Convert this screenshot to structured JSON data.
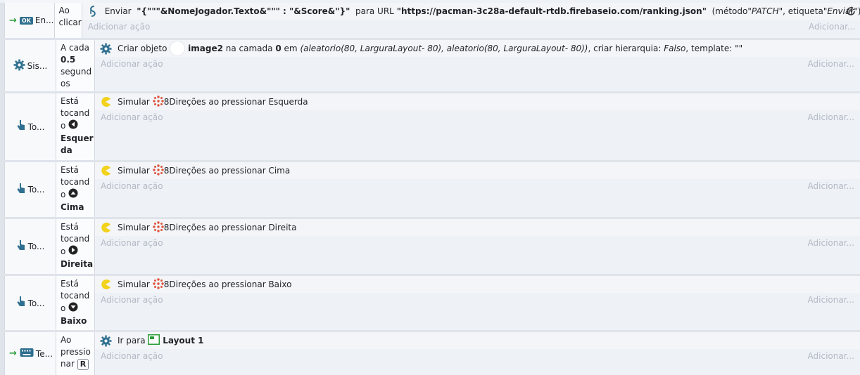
{
  "events": [
    {
      "object_label": "En...",
      "condition_lines": [
        "Ao",
        "clicar"
      ],
      "action": {
        "prefix": "Enviar",
        "body": "\"{\"\"\"&NomeJogador.Texto&\"\"\" : \"&Score&\"}\"",
        "mid": "para URL",
        "url": "\"https://pacman-3c28a-default-rtdb.firebaseio.com/ranking.json\"",
        "paren_open": "(método ",
        "method": "\"PATCH\"",
        "tag_label": ", etiqueta ",
        "tag": "\"Enviar\"",
        "paren_close": ")"
      },
      "add_action": "Adicionar ação",
      "add_right": "Adicionar..."
    },
    {
      "object_label": "Sis...",
      "condition_lines": [
        "A cada",
        "0.5",
        "segund",
        "os"
      ],
      "action": {
        "prefix": "Criar objeto",
        "object_name": "image2",
        "layer_label": "na camada",
        "layer": "0",
        "pos_label": "em",
        "pos": "(aleatorio(80, LarguraLayout- 80), aleatorio(80, LarguraLayout- 80))",
        "hier_label": ", criar hierarquia:",
        "hier": "Falso",
        "tpl_label": ", template:",
        "tpl": "\"\""
      },
      "add_action": "Adicionar ação",
      "add_right": "Adicionar..."
    },
    {
      "object_label": "To...",
      "condition_lines": [
        "Está",
        "tocand",
        "o",
        "Esquer",
        "da"
      ],
      "action": {
        "prefix": "Simular",
        "behavior": "8Direções",
        "text": "ao pressionar Esquerda"
      },
      "add_action": "Adicionar ação",
      "add_right": "Adicionar..."
    },
    {
      "object_label": "To...",
      "condition_lines": [
        "Está",
        "tocand",
        "o",
        "Cima"
      ],
      "action": {
        "prefix": "Simular",
        "behavior": "8Direções",
        "text": "ao pressionar Cima"
      },
      "add_action": "Adicionar ação",
      "add_right": "Adicionar..."
    },
    {
      "object_label": "To...",
      "condition_lines": [
        "Está",
        "tocand",
        "o",
        "Direita"
      ],
      "action": {
        "prefix": "Simular",
        "behavior": "8Direções",
        "text": "ao pressionar Direita"
      },
      "add_action": "Adicionar ação",
      "add_right": "Adicionar..."
    },
    {
      "object_label": "To...",
      "condition_lines": [
        "Está",
        "tocand",
        "o",
        "Baixo"
      ],
      "action": {
        "prefix": "Simular",
        "behavior": "8Direções",
        "text": "ao pressionar Baixo"
      },
      "add_action": "Adicionar ação",
      "add_right": "Adicionar..."
    },
    {
      "object_label": "Te...",
      "condition_lines": [
        "Ao",
        "pressio",
        "nar",
        "R"
      ],
      "action": {
        "prefix": "Ir para",
        "target": "Layout 1"
      },
      "add_action": "Adicionar ação",
      "add_right": "Adicionar..."
    }
  ],
  "icons": {
    "ajax": "ajax-icon",
    "system": "gear-icon",
    "touch": "touch-hand-icon",
    "keyboard": "keyboard-icon",
    "trigger_arrow": "trigger-arrow-icon",
    "pacman": "pacman-icon",
    "behavior": "8-direction-icon",
    "layout": "layout-icon",
    "refresh": "refresh-icon"
  },
  "colors": {
    "accent": "#2f6f8f",
    "trigger": "#2a9d38",
    "behavior": "#e0533c",
    "pacman": "#f2d21b",
    "layout": "#2a9d38"
  }
}
